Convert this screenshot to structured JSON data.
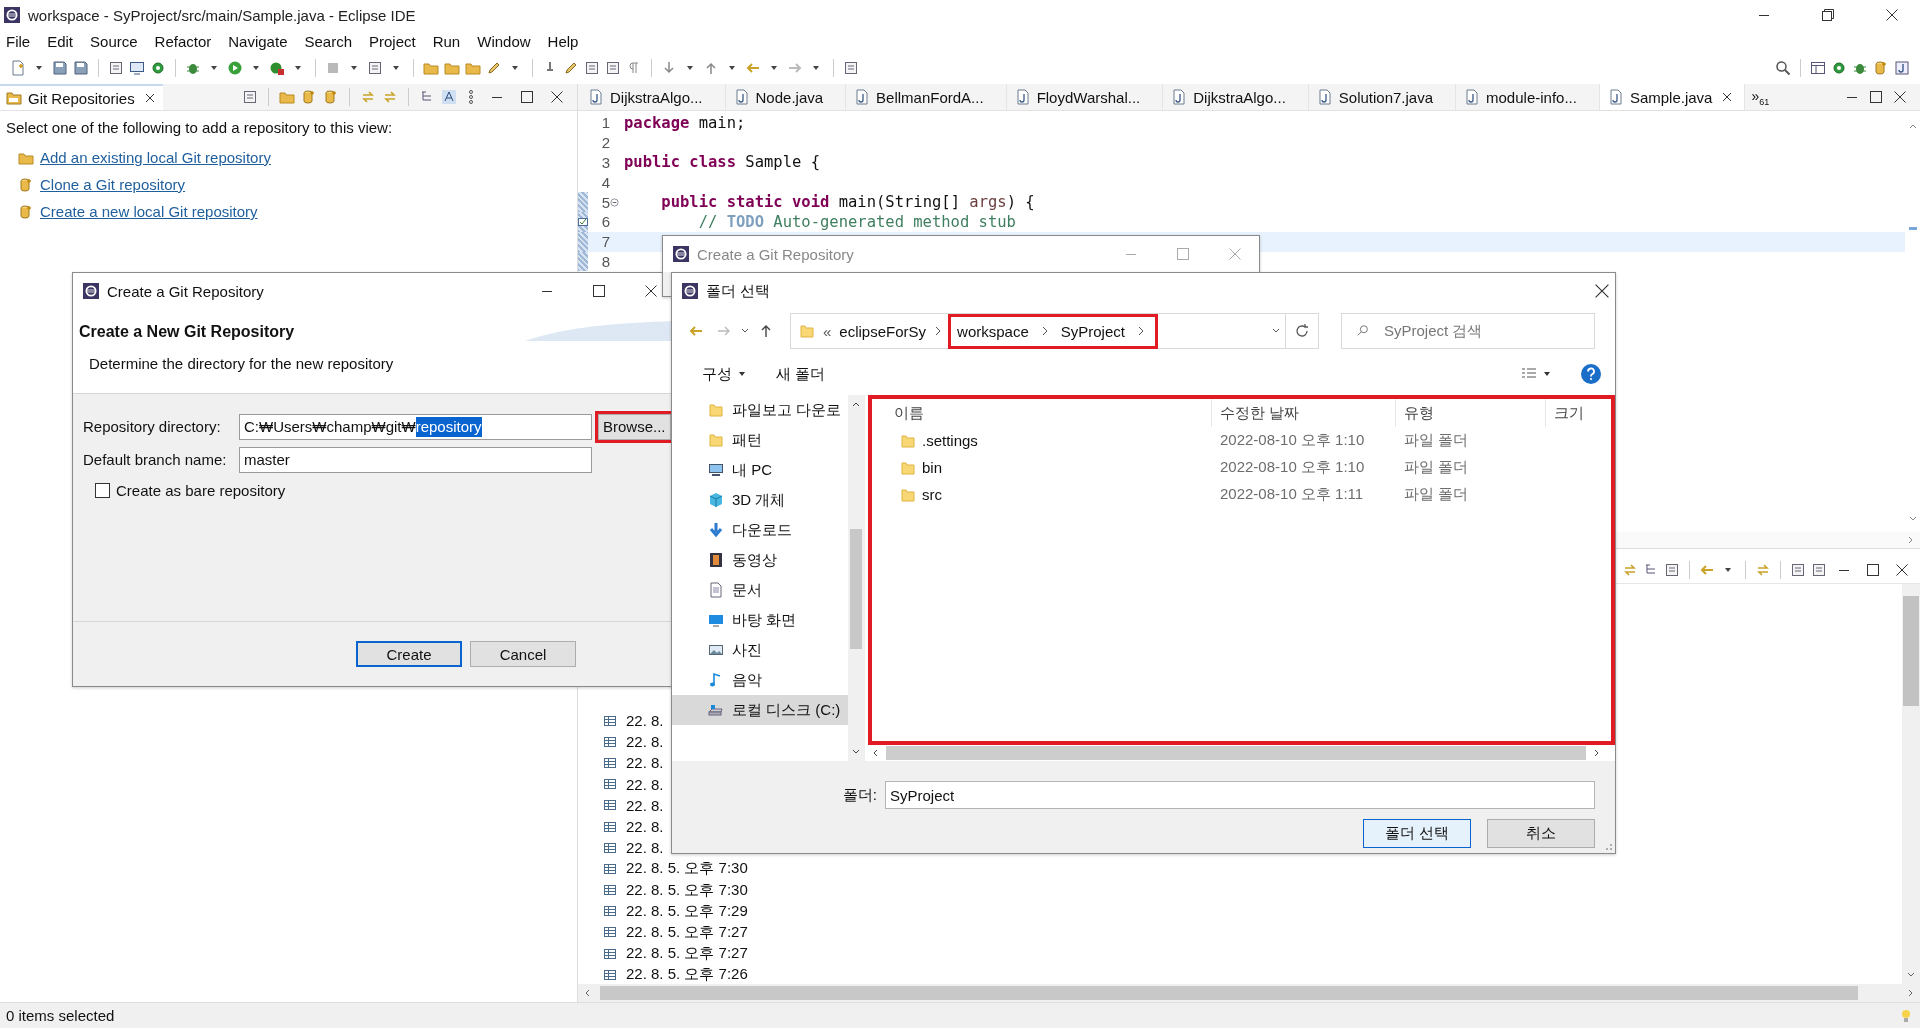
{
  "window": {
    "title": "workspace - SyProject/src/main/Sample.java - Eclipse IDE"
  },
  "menu": [
    "File",
    "Edit",
    "Source",
    "Refactor",
    "Navigate",
    "Search",
    "Project",
    "Run",
    "Window",
    "Help"
  ],
  "git_view": {
    "tab": {
      "label": "Git Repositories",
      "selected": true
    },
    "intro": "Select one of the following to add a repository to this view:",
    "links": [
      {
        "label": "Add an existing local Git repository",
        "kind": "add"
      },
      {
        "label": "Clone a Git repository",
        "kind": "clone"
      },
      {
        "label": "Create a new local Git repository",
        "kind": "create"
      }
    ]
  },
  "editor": {
    "tabs": [
      {
        "label": "DijkstraAlgo...",
        "selected": false
      },
      {
        "label": "Node.java",
        "selected": false
      },
      {
        "label": "BellmanFordA...",
        "selected": false
      },
      {
        "label": "FloydWarshal...",
        "selected": false
      },
      {
        "label": "DijkstraAlgo...",
        "selected": false
      },
      {
        "label": "Solution7.java",
        "selected": false
      },
      {
        "label": "module-info...",
        "selected": false
      },
      {
        "label": "Sample.java",
        "selected": true
      }
    ],
    "overflow": {
      "mark": "»",
      "count": "61"
    },
    "lines": [
      {
        "number": "1",
        "current": false,
        "changed": false,
        "foldable": false,
        "task": false,
        "tokens": [
          {
            "kind": "keyword",
            "text": "package"
          },
          {
            "kind": "plain",
            "text": " main;"
          }
        ]
      },
      {
        "number": "2",
        "current": false,
        "changed": false,
        "foldable": false,
        "task": false
      },
      {
        "number": "3",
        "current": false,
        "changed": false,
        "foldable": false,
        "task": false,
        "tokens": [
          {
            "kind": "keyword",
            "text": "public"
          },
          {
            "kind": "keyword",
            "text": " class"
          },
          {
            "kind": "plain",
            "text": " Sample {"
          }
        ]
      },
      {
        "number": "4",
        "current": false,
        "changed": false,
        "foldable": false,
        "task": false
      },
      {
        "number": "5",
        "current": false,
        "changed": true,
        "foldable": true,
        "task": false,
        "tokens": [
          {
            "kind": "keyword",
            "text": "    public"
          },
          {
            "kind": "keyword",
            "text": " static"
          },
          {
            "kind": "keyword",
            "text": " void"
          },
          {
            "kind": "plain",
            "text": " main(String[] "
          },
          {
            "kind": "param",
            "text": "args"
          },
          {
            "kind": "plain",
            "text": ") {"
          }
        ]
      },
      {
        "number": "6",
        "current": false,
        "changed": true,
        "foldable": false,
        "task": true,
        "tokens": [
          {
            "kind": "comment",
            "text": "        // "
          },
          {
            "kind": "todo",
            "text": "TODO"
          },
          {
            "kind": "comment",
            "text": " Auto-generated method stub"
          }
        ]
      },
      {
        "number": "7",
        "current": true,
        "changed": true,
        "foldable": false,
        "task": false
      },
      {
        "number": "8",
        "current": false,
        "changed": true,
        "foldable": false,
        "task": false
      }
    ]
  },
  "history": {
    "rows": [
      "22. 8.",
      "22. 8.",
      "22. 8.",
      "22. 8.",
      "22. 8.",
      "22. 8.",
      "22. 8.",
      "22. 8. 5. 오후 7:30",
      "22. 8. 5. 오후 7:30",
      "22. 8. 5. 오후 7:29",
      "22. 8. 5. 오후 7:27",
      "22. 8. 5. 오후 7:27",
      "22. 8. 5. 오후 7:26"
    ]
  },
  "status_bar": {
    "text": "0 items selected"
  },
  "create_dialog": {
    "title": "Create a Git Repository",
    "heading": "Create a New Git Repository",
    "description": "Determine the directory for the new repository",
    "directory": {
      "label": "Repository directory:",
      "value": "C:₩Users₩champ₩git₩",
      "selected_part": "repository"
    },
    "browse": {
      "label": "Browse...",
      "highlighted": true
    },
    "branch": {
      "label": "Default branch name:",
      "value": "master"
    },
    "bare": {
      "label": "Create as bare repository",
      "checked": false
    },
    "buttons": [
      {
        "label": "Create",
        "default": true
      },
      {
        "label": "Cancel",
        "default": false
      }
    ]
  },
  "back_dialog": {
    "title": "Create a Git Repository"
  },
  "folder_dialog": {
    "title": "폴더 선택",
    "path_overflow": "«",
    "path": [
      {
        "label": "eclipseForSy",
        "highlighted": false
      },
      {
        "label": "workspace",
        "highlighted": true
      },
      {
        "label": "SyProject",
        "highlighted": true
      }
    ],
    "search_placeholder": "SyProject 검색",
    "commands": [
      "구성",
      "새 폴더"
    ],
    "nav": [
      {
        "label": "파일보고 다운로",
        "kind": "folder",
        "selected": false
      },
      {
        "label": "패턴",
        "kind": "folder",
        "selected": false
      },
      {
        "label": "내 PC",
        "kind": "pc",
        "selected": false
      },
      {
        "label": "3D 개체",
        "kind": "cube",
        "selected": false
      },
      {
        "label": "다운로드",
        "kind": "download",
        "selected": false
      },
      {
        "label": "동영상",
        "kind": "video",
        "selected": false
      },
      {
        "label": "문서",
        "kind": "document",
        "selected": false
      },
      {
        "label": "바탕 화면",
        "kind": "desktop",
        "selected": false
      },
      {
        "label": "사진",
        "kind": "picture",
        "selected": false
      },
      {
        "label": "음악",
        "kind": "music",
        "selected": false
      },
      {
        "label": "로컬 디스크 (C:)",
        "kind": "drive",
        "selected": true
      }
    ],
    "list_highlighted": true,
    "columns": [
      "이름",
      "수정한 날짜",
      "유형",
      "크기"
    ],
    "files": [
      {
        "name": ".settings",
        "modified": "2022-08-10 오후 1:10",
        "type": "파일 폴더"
      },
      {
        "name": "bin",
        "modified": "2022-08-10 오후 1:10",
        "type": "파일 폴더"
      },
      {
        "name": "src",
        "modified": "2022-08-10 오후 1:11",
        "type": "파일 폴더"
      }
    ],
    "folder_label": "폴더:",
    "folder_value": "SyProject",
    "buttons": [
      {
        "label": "폴더 선택",
        "default": true
      },
      {
        "label": "취소",
        "default": false
      }
    ]
  }
}
